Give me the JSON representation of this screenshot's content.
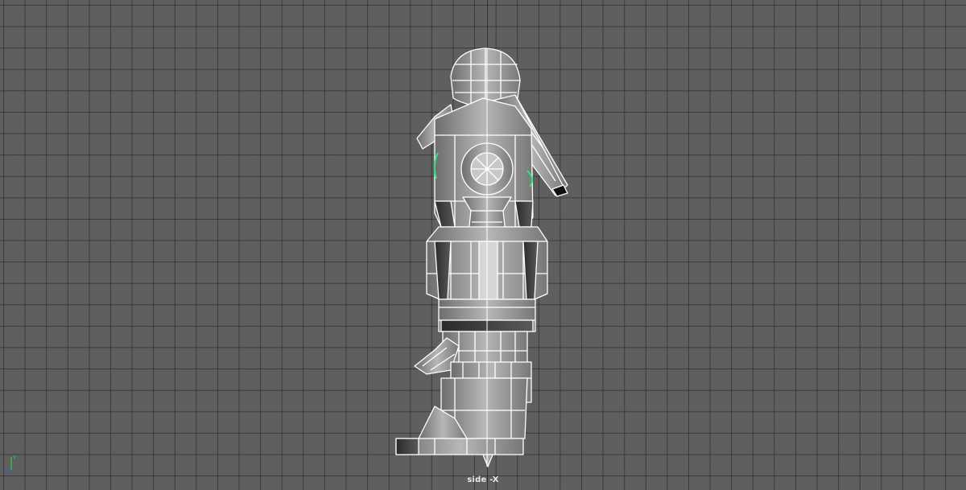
{
  "viewport": {
    "camera_label": "side -X",
    "background_color": "#5f5f5f",
    "grid_color": "#3a3a3a",
    "wire_color": "#ffffff",
    "mesh_fill_color": "#8a8a8a",
    "highlight_color": "#33e07a"
  },
  "axis_gizmo": {
    "vertical_axis": "Y",
    "vertical_color": "#35c24a",
    "horizontal_color": "#3a5bd6"
  },
  "model": {
    "icon": "robot-mesh-wireframe"
  }
}
